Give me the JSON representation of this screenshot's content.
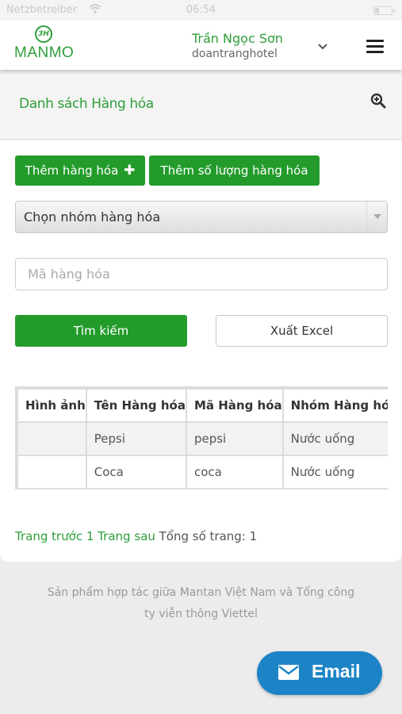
{
  "status_bar": {
    "carrier": "Netzbetreiber",
    "time": "06:54"
  },
  "header": {
    "logo_mark": "3H",
    "logo_text": "MANMO",
    "user_name": "Trần Ngọc Sơn",
    "user_sub": "doantranghotel"
  },
  "page": {
    "title": "Danh sách Hàng hóa"
  },
  "actions": {
    "add_label": "Thêm hàng hóa",
    "add_plus": "✚",
    "add_qty_label": "Thêm số lượng hàng hóa",
    "group_select": "Chọn nhóm hàng hóa",
    "code_placeholder": "Mã hàng hóa",
    "search_label": "Tìm kiếm",
    "excel_label": "Xuất Excel"
  },
  "table": {
    "headers": [
      "Hình ảnh",
      "Tên Hàng hóa",
      "Mã Hàng hóa",
      "Nhóm Hàng hóa"
    ],
    "rows": [
      {
        "image": "",
        "name": "Pepsi",
        "code": "pepsi",
        "group": "Nước uống"
      },
      {
        "image": "",
        "name": "Coca",
        "code": "coca",
        "group": "Nước uống"
      }
    ]
  },
  "pagination": {
    "prev": "Trang trước",
    "page": "1",
    "next": "Trang sau",
    "total": "Tổng số trang: 1"
  },
  "footer": {
    "line1": "Sản phẩm hợp tác giữa Mantan Việt Nam và Tổng công",
    "line2": "ty viễn thông Viettel"
  },
  "email_button": {
    "label": "Email"
  },
  "colors": {
    "brand_green": "#239b2b",
    "email_blue": "#1c84c6"
  }
}
